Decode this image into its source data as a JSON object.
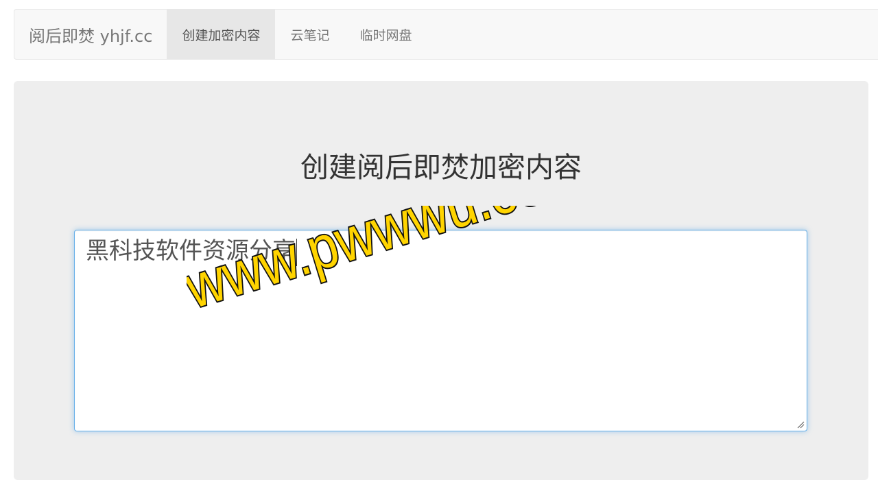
{
  "navbar": {
    "brand": "阅后即焚 yhjf.cc",
    "items": [
      {
        "label": "创建加密内容",
        "active": true
      },
      {
        "label": "云笔记",
        "active": false
      },
      {
        "label": "临时网盘",
        "active": false
      }
    ]
  },
  "main": {
    "title": "创建阅后即焚加密内容",
    "editor_value": "黑科技软件资源分享"
  },
  "watermark": {
    "text": "www.pwwwu.com",
    "fill": "#ffd400",
    "outline": "#111111"
  },
  "colors": {
    "active_tab_bg": "#e7e7e7",
    "panel_bg": "#eeeeee",
    "focus_border": "#66afe9"
  }
}
